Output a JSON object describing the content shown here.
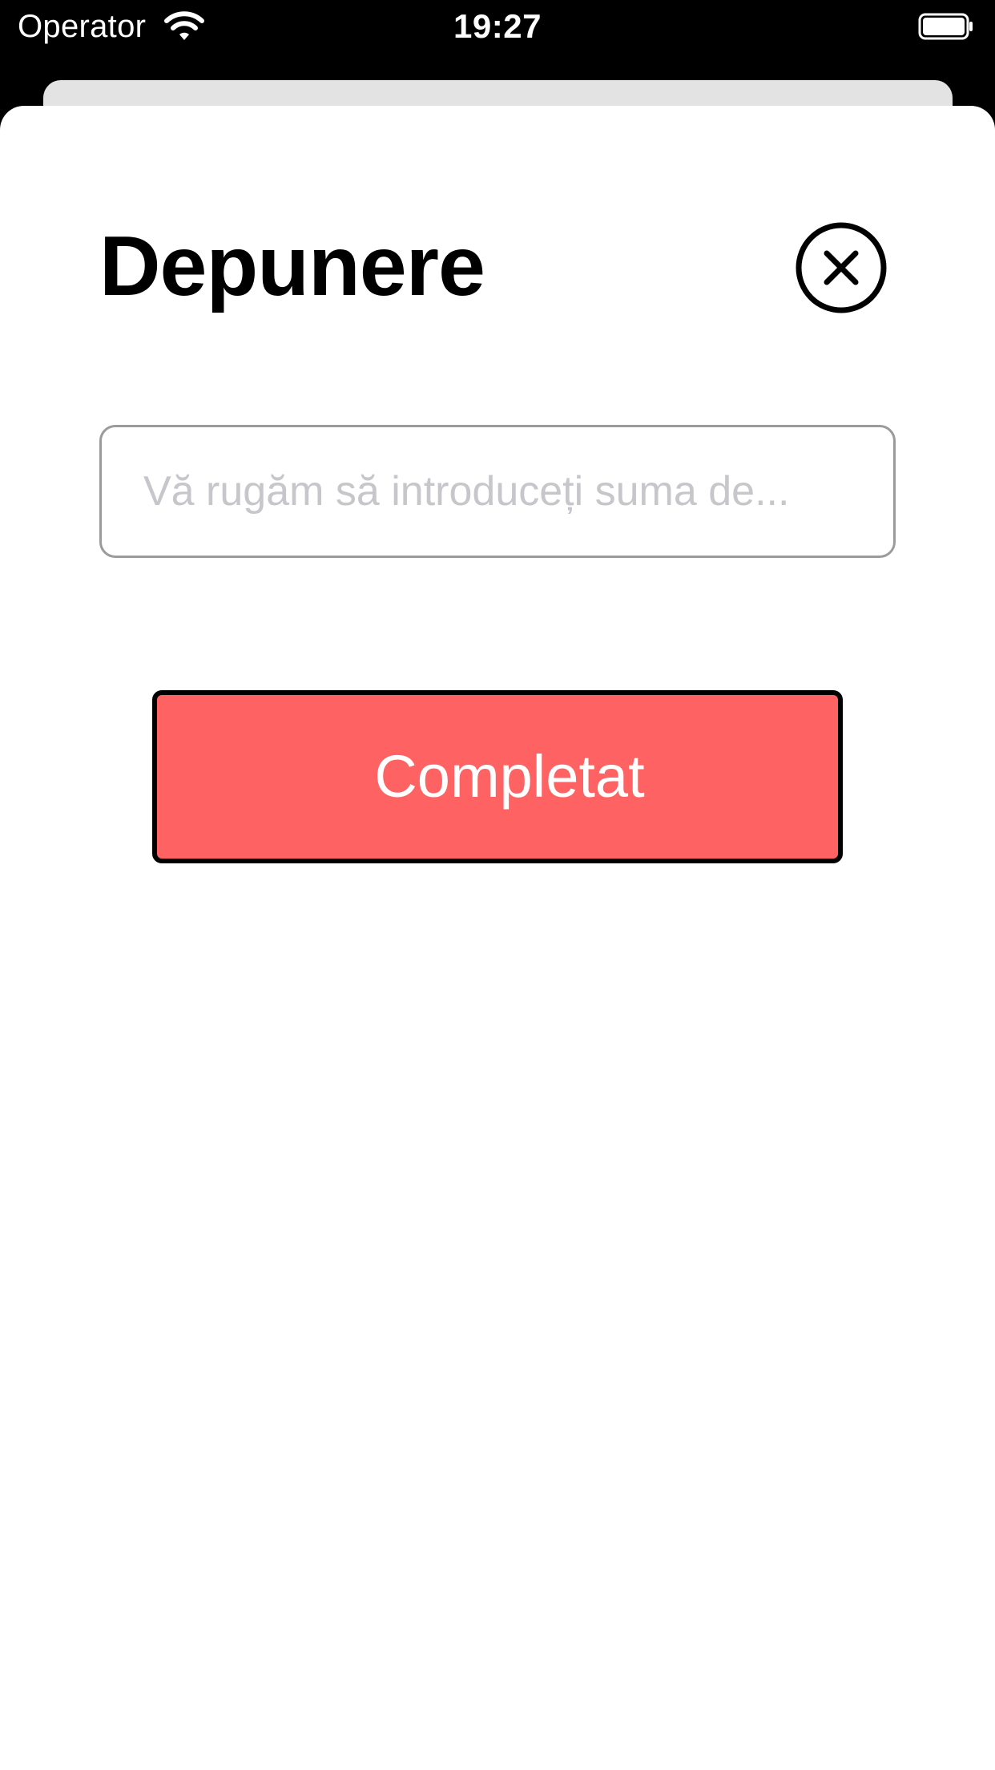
{
  "status_bar": {
    "carrier": "Operator",
    "time": "19:27",
    "wifi_icon": "wifi-icon",
    "battery_icon": "battery-icon"
  },
  "sheet": {
    "title": "Depunere",
    "close_icon": "close-circle-icon",
    "amount_input": {
      "placeholder": "Vă rugăm să introduceți suma de...",
      "value": ""
    },
    "submit_label": "Completat"
  },
  "colors": {
    "submit_background": "#ff6262",
    "submit_border": "#000000",
    "input_border": "#9b9b9b",
    "placeholder": "#c7c7cb",
    "underlying_card": "#e3e3e3"
  }
}
